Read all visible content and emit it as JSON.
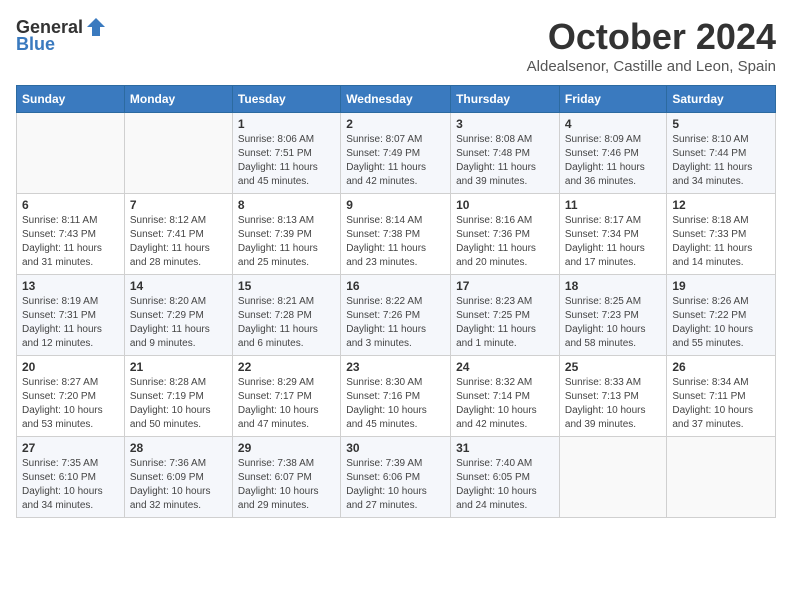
{
  "logo": {
    "general": "General",
    "blue": "Blue"
  },
  "header": {
    "month": "October 2024",
    "location": "Aldealsenor, Castille and Leon, Spain"
  },
  "weekdays": [
    "Sunday",
    "Monday",
    "Tuesday",
    "Wednesday",
    "Thursday",
    "Friday",
    "Saturday"
  ],
  "weeks": [
    [
      {
        "day": "",
        "info": ""
      },
      {
        "day": "",
        "info": ""
      },
      {
        "day": "1",
        "info": "Sunrise: 8:06 AM\nSunset: 7:51 PM\nDaylight: 11 hours and 45 minutes."
      },
      {
        "day": "2",
        "info": "Sunrise: 8:07 AM\nSunset: 7:49 PM\nDaylight: 11 hours and 42 minutes."
      },
      {
        "day": "3",
        "info": "Sunrise: 8:08 AM\nSunset: 7:48 PM\nDaylight: 11 hours and 39 minutes."
      },
      {
        "day": "4",
        "info": "Sunrise: 8:09 AM\nSunset: 7:46 PM\nDaylight: 11 hours and 36 minutes."
      },
      {
        "day": "5",
        "info": "Sunrise: 8:10 AM\nSunset: 7:44 PM\nDaylight: 11 hours and 34 minutes."
      }
    ],
    [
      {
        "day": "6",
        "info": "Sunrise: 8:11 AM\nSunset: 7:43 PM\nDaylight: 11 hours and 31 minutes."
      },
      {
        "day": "7",
        "info": "Sunrise: 8:12 AM\nSunset: 7:41 PM\nDaylight: 11 hours and 28 minutes."
      },
      {
        "day": "8",
        "info": "Sunrise: 8:13 AM\nSunset: 7:39 PM\nDaylight: 11 hours and 25 minutes."
      },
      {
        "day": "9",
        "info": "Sunrise: 8:14 AM\nSunset: 7:38 PM\nDaylight: 11 hours and 23 minutes."
      },
      {
        "day": "10",
        "info": "Sunrise: 8:16 AM\nSunset: 7:36 PM\nDaylight: 11 hours and 20 minutes."
      },
      {
        "day": "11",
        "info": "Sunrise: 8:17 AM\nSunset: 7:34 PM\nDaylight: 11 hours and 17 minutes."
      },
      {
        "day": "12",
        "info": "Sunrise: 8:18 AM\nSunset: 7:33 PM\nDaylight: 11 hours and 14 minutes."
      }
    ],
    [
      {
        "day": "13",
        "info": "Sunrise: 8:19 AM\nSunset: 7:31 PM\nDaylight: 11 hours and 12 minutes."
      },
      {
        "day": "14",
        "info": "Sunrise: 8:20 AM\nSunset: 7:29 PM\nDaylight: 11 hours and 9 minutes."
      },
      {
        "day": "15",
        "info": "Sunrise: 8:21 AM\nSunset: 7:28 PM\nDaylight: 11 hours and 6 minutes."
      },
      {
        "day": "16",
        "info": "Sunrise: 8:22 AM\nSunset: 7:26 PM\nDaylight: 11 hours and 3 minutes."
      },
      {
        "day": "17",
        "info": "Sunrise: 8:23 AM\nSunset: 7:25 PM\nDaylight: 11 hours and 1 minute."
      },
      {
        "day": "18",
        "info": "Sunrise: 8:25 AM\nSunset: 7:23 PM\nDaylight: 10 hours and 58 minutes."
      },
      {
        "day": "19",
        "info": "Sunrise: 8:26 AM\nSunset: 7:22 PM\nDaylight: 10 hours and 55 minutes."
      }
    ],
    [
      {
        "day": "20",
        "info": "Sunrise: 8:27 AM\nSunset: 7:20 PM\nDaylight: 10 hours and 53 minutes."
      },
      {
        "day": "21",
        "info": "Sunrise: 8:28 AM\nSunset: 7:19 PM\nDaylight: 10 hours and 50 minutes."
      },
      {
        "day": "22",
        "info": "Sunrise: 8:29 AM\nSunset: 7:17 PM\nDaylight: 10 hours and 47 minutes."
      },
      {
        "day": "23",
        "info": "Sunrise: 8:30 AM\nSunset: 7:16 PM\nDaylight: 10 hours and 45 minutes."
      },
      {
        "day": "24",
        "info": "Sunrise: 8:32 AM\nSunset: 7:14 PM\nDaylight: 10 hours and 42 minutes."
      },
      {
        "day": "25",
        "info": "Sunrise: 8:33 AM\nSunset: 7:13 PM\nDaylight: 10 hours and 39 minutes."
      },
      {
        "day": "26",
        "info": "Sunrise: 8:34 AM\nSunset: 7:11 PM\nDaylight: 10 hours and 37 minutes."
      }
    ],
    [
      {
        "day": "27",
        "info": "Sunrise: 7:35 AM\nSunset: 6:10 PM\nDaylight: 10 hours and 34 minutes."
      },
      {
        "day": "28",
        "info": "Sunrise: 7:36 AM\nSunset: 6:09 PM\nDaylight: 10 hours and 32 minutes."
      },
      {
        "day": "29",
        "info": "Sunrise: 7:38 AM\nSunset: 6:07 PM\nDaylight: 10 hours and 29 minutes."
      },
      {
        "day": "30",
        "info": "Sunrise: 7:39 AM\nSunset: 6:06 PM\nDaylight: 10 hours and 27 minutes."
      },
      {
        "day": "31",
        "info": "Sunrise: 7:40 AM\nSunset: 6:05 PM\nDaylight: 10 hours and 24 minutes."
      },
      {
        "day": "",
        "info": ""
      },
      {
        "day": "",
        "info": ""
      }
    ]
  ]
}
